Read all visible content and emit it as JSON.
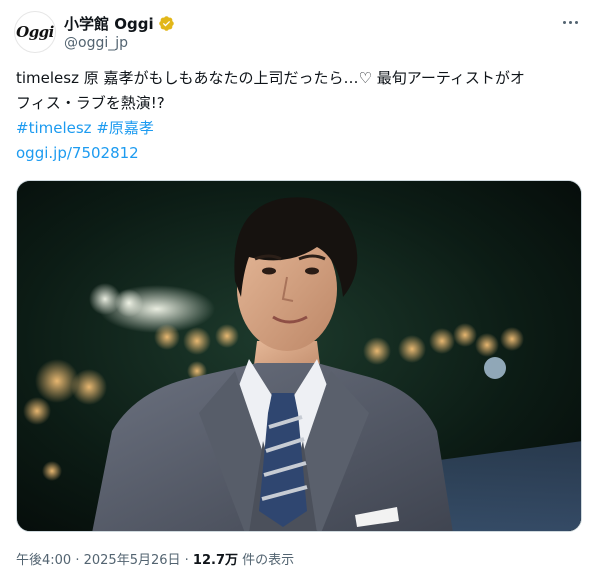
{
  "account": {
    "avatar_text": "Oggi",
    "display_name": "小学館 Oggi",
    "handle": "@oggi_jp",
    "verified_icon": "verified-badge-gold"
  },
  "tweet": {
    "text_line1": "timelesz 原 嘉孝がもしもあなたの上司だったら…♡ 最旬アーティストがオ",
    "text_line2": "フィス・ラブを熱演!?",
    "hashtag1": "#timelesz",
    "hashtag2": "#原嘉孝",
    "link": "oggi.jp/7502812"
  },
  "meta": {
    "time": "午後4:00",
    "separator1": " · ",
    "date": "2025年5月26日",
    "separator2": " · ",
    "views_count": "12.7万",
    "views_label": " 件の表示"
  },
  "colors": {
    "link": "#1d9bf0",
    "secondary_text": "#536471",
    "verified_gold": "#e2b719"
  }
}
